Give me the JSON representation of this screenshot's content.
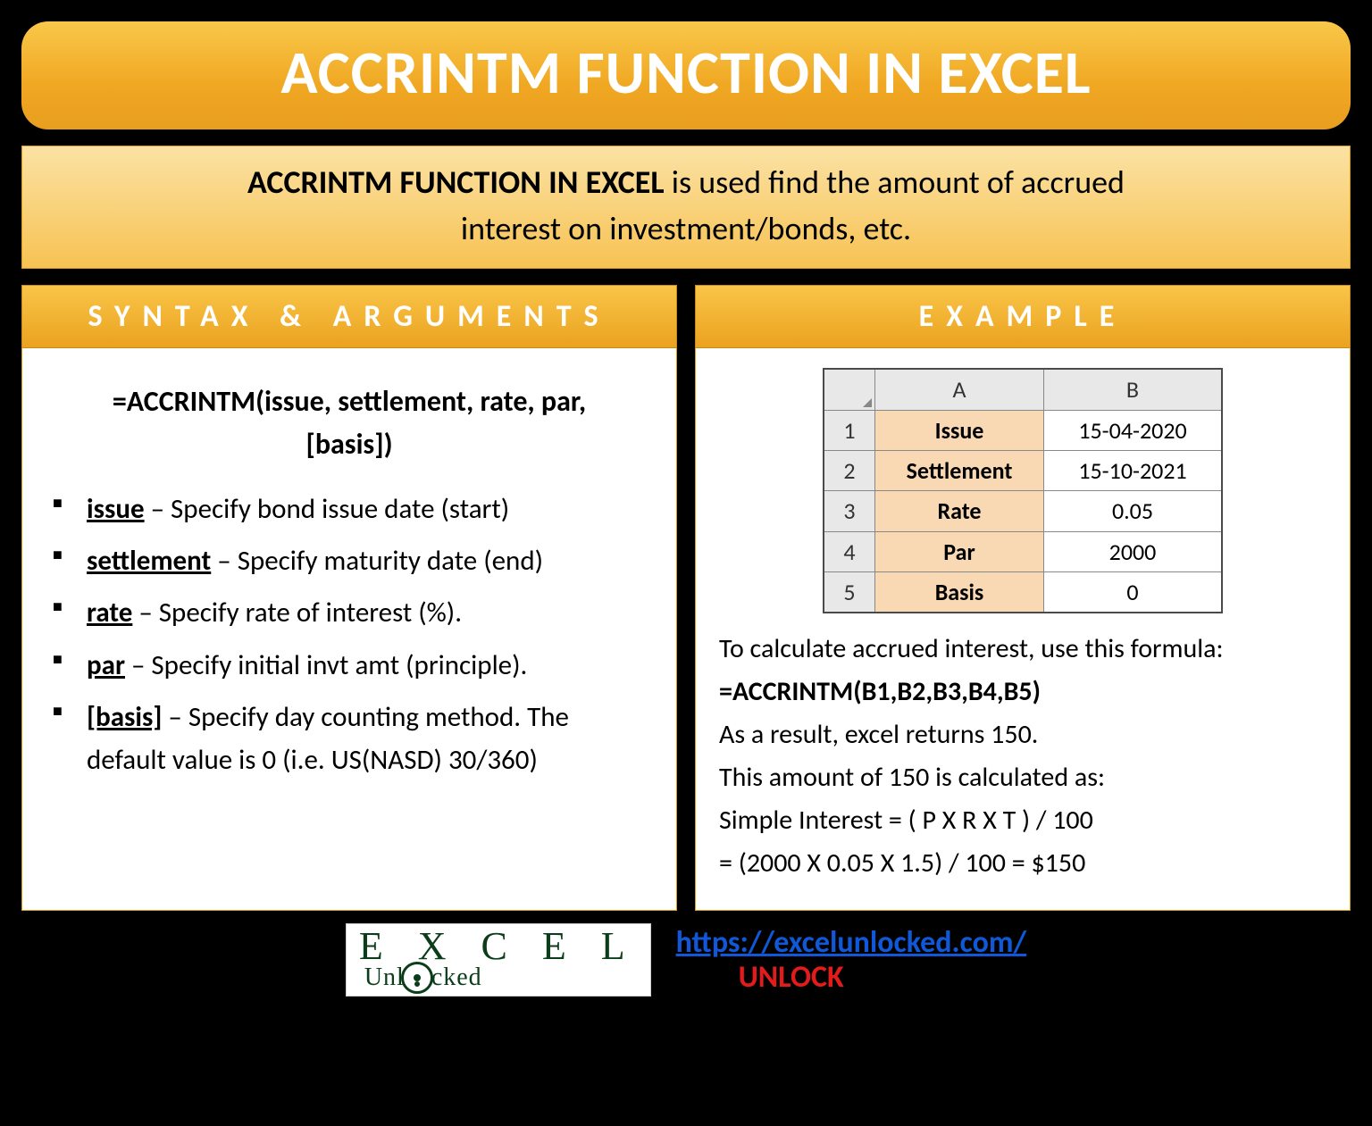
{
  "title": "ACCRINTM FUNCTION IN EXCEL",
  "intro": {
    "strong": "ACCRINTM FUNCTION IN EXCEL",
    "rest1": " is used find the amount of accrued",
    "line2": "interest on investment/bonds, etc."
  },
  "left": {
    "header": "SYNTAX & ARGUMENTS",
    "formula_l1": "=ACCRINTM(issue, settlement, rate, par,",
    "formula_l2": "[basis])",
    "args": [
      {
        "name": "issue",
        "desc": " – Specify bond issue date (start)"
      },
      {
        "name": "settlement",
        "desc": " – Specify maturity date (end)"
      },
      {
        "name": "rate",
        "desc": " – Specify rate of interest (%)."
      },
      {
        "name": "par",
        "desc": " – Specify initial invt amt (principle)."
      },
      {
        "name": "[basis]",
        "desc": " – Specify day counting method. The default value is 0 (i.e. US(NASD) 30/360)"
      }
    ]
  },
  "right": {
    "header": "EXAMPLE",
    "grid": {
      "colA": "A",
      "colB": "B",
      "rows": [
        {
          "n": "1",
          "label": "Issue",
          "value": "15-04-2020"
        },
        {
          "n": "2",
          "label": "Settlement",
          "value": "15-10-2021"
        },
        {
          "n": "3",
          "label": "Rate",
          "value": "0.05"
        },
        {
          "n": "4",
          "label": "Par",
          "value": "2000"
        },
        {
          "n": "5",
          "label": "Basis",
          "value": "0"
        }
      ]
    },
    "p1": "To calculate accrued interest, use this formula:",
    "formula": "=ACCRINTM(B1,B2,B3,B4,B5)",
    "p2": "As a result, excel returns 150.",
    "p3": "This amount of 150 is calculated as:",
    "p4": "Simple Interest = ( P X R X T ) / 100",
    "p5": "= (2000 X 0.05 X 1.5) / 100 = $150"
  },
  "footer": {
    "logo_top_pre": "E X C",
    "logo_top_post": "E L",
    "logo_bot_pre": "Unl",
    "logo_bot_post": "cked",
    "url": "https://excelunlocked.com/",
    "unlock": "UNLOCK"
  }
}
